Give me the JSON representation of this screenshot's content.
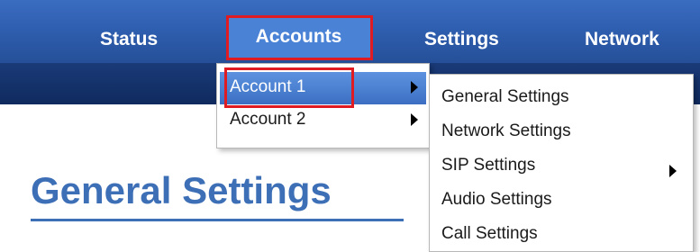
{
  "nav": {
    "items": [
      {
        "label": "Status"
      },
      {
        "label": "Accounts"
      },
      {
        "label": "Settings"
      },
      {
        "label": "Network"
      }
    ],
    "active": "Accounts"
  },
  "accounts_menu": {
    "items": [
      {
        "label": "Account 1",
        "highlighted": true,
        "has_submenu": true
      },
      {
        "label": "Account 2",
        "highlighted": false,
        "has_submenu": true
      }
    ]
  },
  "account_submenu": {
    "items": [
      {
        "label": "General Settings"
      },
      {
        "label": "Network Settings"
      },
      {
        "label": "SIP Settings",
        "has_submenu": true
      },
      {
        "label": "Audio Settings"
      },
      {
        "label": "Call Settings"
      }
    ]
  },
  "page": {
    "title": "General Settings"
  },
  "colors": {
    "nav_bar": "#2f5fb0",
    "sub_band": "#0f2a5e",
    "title": "#3d6fb6",
    "highlight_box": "#e11b22",
    "menu_highlight": "#4a82d6"
  }
}
